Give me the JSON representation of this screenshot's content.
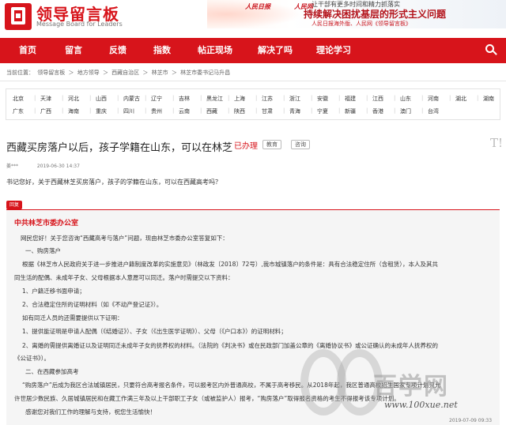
{
  "brand": {
    "title": "领导留言板",
    "subtitle": "Message Board for Leaders"
  },
  "banner": {
    "logo_left": "人民日报",
    "logo_right": "人民网",
    "line1": "让干部有更多时间和精力抓落实",
    "line2": "持续解决困扰基层的形式主义问题",
    "line3": "人民日报海外版、人民网《领导留言板》"
  },
  "nav": {
    "items": [
      "首页",
      "留言",
      "反馈",
      "指数",
      "帖正现场",
      "解决了吗",
      "理论学习"
    ]
  },
  "breadcrumb": {
    "items": [
      "当前位置：",
      "领导留言板",
      "＞",
      "地方领导",
      "＞",
      "西藏自治区",
      "＞",
      "林芝市",
      "＞",
      "林芝市委书记马升昌"
    ]
  },
  "regions": {
    "row1": [
      "北京",
      "天津",
      "河北",
      "山西",
      "内蒙古",
      "辽宁",
      "吉林",
      "黑龙江",
      "上海",
      "江苏",
      "浙江",
      "安徽",
      "福建",
      "江西",
      "山东",
      "河南",
      "湖北",
      "湖南"
    ],
    "row2": [
      "广东",
      "广西",
      "海南",
      "重庆",
      "四川",
      "贵州",
      "云南",
      "西藏",
      "陕西",
      "甘肃",
      "青海",
      "宁夏",
      "新疆",
      "香港",
      "澳门",
      "台湾"
    ]
  },
  "post": {
    "title": "西藏买房落户以后，孩子学籍在山东，可以在林芝",
    "status": "已办理",
    "tags": [
      "教育",
      "咨询"
    ],
    "corner": "T!",
    "author": "姜***",
    "date": "2019-06-30 14:37",
    "question": "书记您好，关于西藏林芝买房落户，孩子的学籍在山东，可以在西藏高考吗？"
  },
  "reply": {
    "tab": "回复",
    "office": "中共林芝市委办公室",
    "paragraphs": [
      "网民您好！关于您咨询“西藏高考与落户”问题，现由林芝市委办公室答复如下：",
      "一、购房落户",
      "根据《林芝市人民政府关于进一步推进户籍制度改革的实施意见》（林政发〔2018〕72号）,我市城镇落户的条件是：具有合法稳定住所（含租赁），本人及其共",
      "同生活的配偶、未成年子女、父母根据本人意愿可以同迁。落户时需提交以下资料：",
      "1、户籍迁移书面申请；",
      "2、合法稳定住所的证明材料（如《不动产登记证》）。",
      "如有同迁人员的还需要提供以下证明：",
      "1、提供能证明是申请人配偶（《结婚证》）、子女（《出生医学证明》）、父母（《户口本》）的证明材料；",
      "2、离婚的需提供离婚证以及证明同迁未成年子女的抚养权的材料。（法院的《判决书》或在民政部门加盖公章的《离婚协议书》或公证确认的未成年人抚养权的",
      "《公证书》）。",
      "二、在西藏参加高考",
      "“购房落户”后成为我区合法城镇居民，只要符合高考报名条件，可以报考区内外普通高校，不属于高考移民。从2018年起，我区普通高校招生国家专项计划只允",
      "许世居少数民族、久居城镇居民和在藏工作满三年及以上干部职工子女（或被监护人）报考，“购房落户”取得报名资格的考生不得报考该专项计划。",
      "感谢您对我们工作的理解与支持，祝您生活愉快！"
    ],
    "time": "2019-07-09 09:33"
  },
  "watermark": {
    "text": "百学网",
    "url": "www.100xue.net"
  },
  "colors": {
    "brand_red": "#d7141b",
    "reply_bg": "#f5f5f5"
  }
}
